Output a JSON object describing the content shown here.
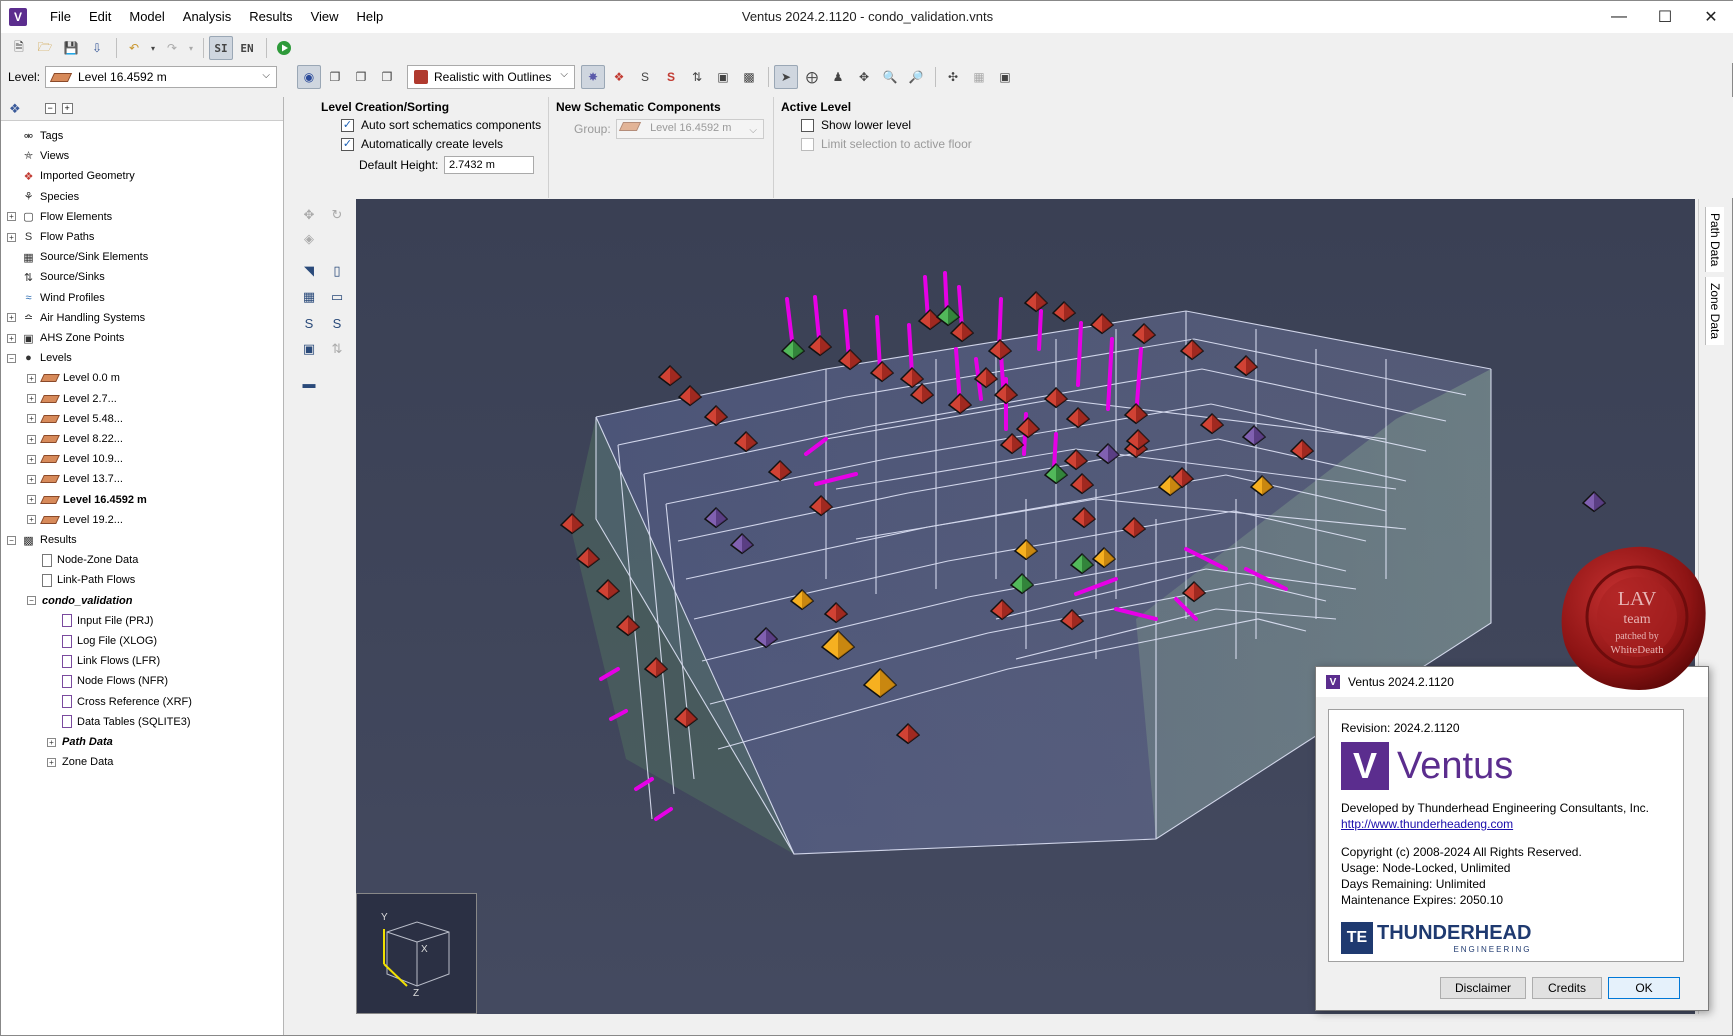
{
  "window": {
    "title": "Ventus 2024.2.1120 - condo_validation.vnts",
    "app_icon": "ventus-logo-icon"
  },
  "menu": [
    "File",
    "Edit",
    "Model",
    "Analysis",
    "Results",
    "View",
    "Help"
  ],
  "toolbar": {
    "si_label": "SI",
    "en_label": "EN"
  },
  "level": {
    "label": "Level:",
    "value": "Level 16.4592 m"
  },
  "render_mode": "Realistic with Outlines",
  "tree": {
    "items": [
      {
        "label": "Tags",
        "icon": "tag-icon",
        "exp": ""
      },
      {
        "label": "Views",
        "icon": "views-icon",
        "exp": ""
      },
      {
        "label": "Imported Geometry",
        "icon": "imported-geometry-icon",
        "exp": ""
      },
      {
        "label": "Species",
        "icon": "species-icon",
        "exp": ""
      },
      {
        "label": "Flow Elements",
        "icon": "flow-elements-icon",
        "exp": "+"
      },
      {
        "label": "Flow Paths",
        "icon": "flow-paths-icon",
        "exp": "+"
      },
      {
        "label": "Source/Sink Elements",
        "icon": "source-sink-elements-icon",
        "exp": ""
      },
      {
        "label": "Source/Sinks",
        "icon": "source-sinks-icon",
        "exp": ""
      },
      {
        "label": "Wind Profiles",
        "icon": "wind-profiles-icon",
        "exp": ""
      },
      {
        "label": "Air Handling Systems",
        "icon": "air-handling-icon",
        "exp": "+"
      },
      {
        "label": "AHS Zone Points",
        "icon": "ahs-zone-points-icon",
        "exp": "+"
      },
      {
        "label": "Levels",
        "icon": "levels-icon",
        "exp": "-"
      }
    ],
    "levels": [
      "Level 0.0 m",
      "Level 2.7...",
      "Level 5.48...",
      "Level 8.22...",
      "Level 10.9...",
      "Level 13.7...",
      "Level 16.4592 m",
      "Level 19.2..."
    ],
    "results_label": "Results",
    "results_items": [
      "Node-Zone Data",
      "Link-Path Flows"
    ],
    "run_label": "condo_validation",
    "run_items": [
      "Input File (PRJ)",
      "Log File (XLOG)",
      "Link Flows (LFR)",
      "Node Flows (NFR)",
      "Cross Reference (XRF)",
      "Data Tables (SQLITE3)"
    ],
    "path_data": "Path Data",
    "zone_data": "Zone Data"
  },
  "props": {
    "level_group_title": "Level Creation/Sorting",
    "auto_sort": "Auto sort schematics components",
    "auto_create": "Automatically create levels",
    "default_height_label": "Default Height:",
    "default_height_value": "2.7432 m",
    "schematic_title": "New Schematic Components",
    "group_label": "Group:",
    "group_value": "Level 16.4592 m",
    "active_title": "Active Level",
    "show_lower": "Show lower level",
    "limit_selection": "Limit selection to active floor"
  },
  "right_tabs": [
    "Path Data",
    "Zone Data"
  ],
  "axis": {
    "y": "Y",
    "x": "X",
    "z": "Z"
  },
  "about": {
    "title": "Ventus 2024.2.1120",
    "revision": "Revision: 2024.2.1120",
    "brand": "Ventus",
    "developer": "Developed by Thunderhead Engineering Consultants, Inc.",
    "url": "http://www.thunderheadeng.com",
    "copyright": "Copyright (c) 2008-2024 All Rights Reserved.",
    "usage": "Usage: Node-Locked, Unlimited",
    "days": "Days Remaining: Unlimited",
    "maintenance": "Maintenance Expires: 2050.10",
    "company_logo": "THUNDERHEAD",
    "company_sub": "ENGINEERING",
    "buttons": {
      "disclaimer": "Disclaimer",
      "credits": "Credits",
      "ok": "OK"
    }
  },
  "seal": {
    "line1": "LAV",
    "line2": "team",
    "line3": "patched by",
    "line4": "WhiteDeath"
  },
  "colors": {
    "accent": "#5b2d8e",
    "viewport_bg": "#3d4356",
    "node_red": "#c23b32",
    "node_orange": "#f0a020",
    "node_green": "#3aa04a",
    "path_magenta": "#e600e6"
  }
}
